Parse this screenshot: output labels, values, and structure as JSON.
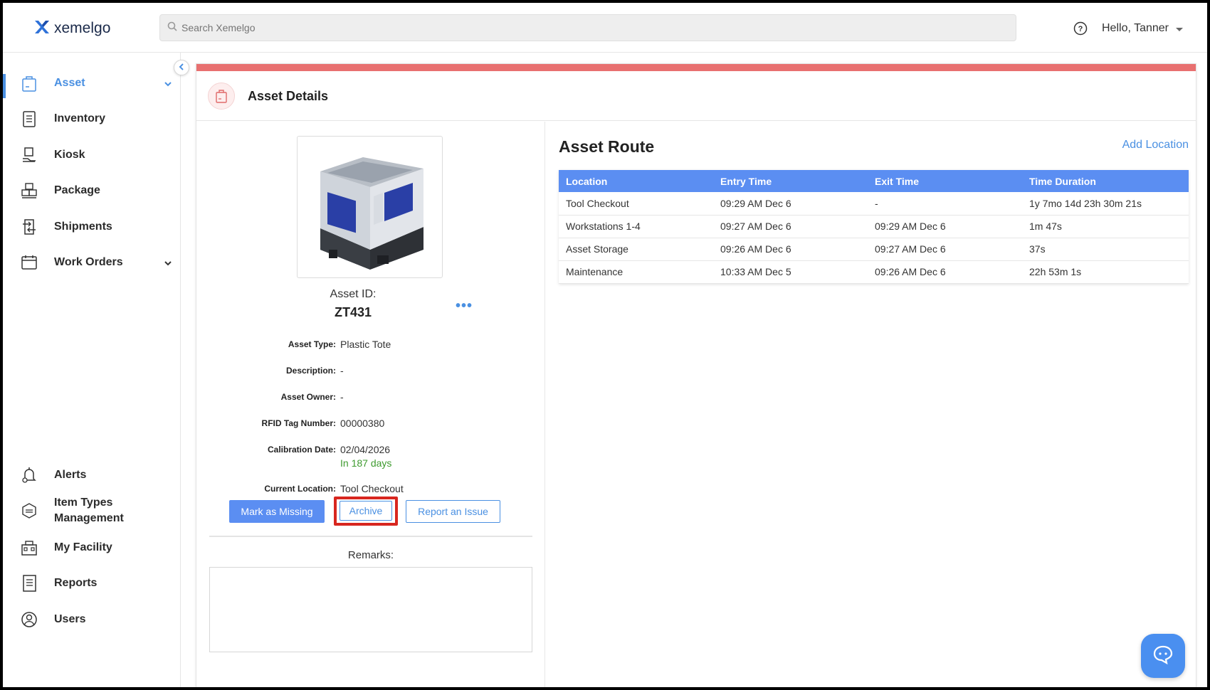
{
  "app": {
    "name": "xemelgo"
  },
  "header": {
    "search_placeholder": "Search Xemelgo",
    "user_greeting": "Hello, Tanner"
  },
  "sidebar": {
    "items": [
      {
        "label": "Asset",
        "icon": "asset-icon",
        "active": true,
        "expandable": true
      },
      {
        "label": "Inventory",
        "icon": "inventory-icon"
      },
      {
        "label": "Kiosk",
        "icon": "kiosk-icon"
      },
      {
        "label": "Package",
        "icon": "package-icon"
      },
      {
        "label": "Shipments",
        "icon": "shipments-icon"
      },
      {
        "label": "Work Orders",
        "icon": "work-orders-icon",
        "expandable": true
      },
      {
        "label": "Alerts",
        "icon": "alerts-icon"
      },
      {
        "label": "Item Types Management",
        "icon": "item-types-icon"
      },
      {
        "label": "My Facility",
        "icon": "facility-icon"
      },
      {
        "label": "Reports",
        "icon": "reports-icon"
      },
      {
        "label": "Users",
        "icon": "users-icon"
      }
    ],
    "accent_color": "#4a90e2"
  },
  "page": {
    "title": "Asset Details",
    "status_color": "#e87070"
  },
  "asset": {
    "id_label": "Asset ID:",
    "id": "ZT431",
    "fields": {
      "type_label": "Asset Type:",
      "type": "Plastic Tote",
      "description_label": "Description:",
      "description": "-",
      "owner_label": "Asset Owner:",
      "owner": "-",
      "rfid_label": "RFID Tag Number:",
      "rfid": "00000380",
      "calibration_label": "Calibration Date:",
      "calibration": "02/04/2026",
      "calibration_note": "In 187 days",
      "location_label": "Current Location:",
      "location": "Tool Checkout"
    },
    "actions": {
      "mark_missing": "Mark as Missing",
      "archive": "Archive",
      "report_issue": "Report an Issue"
    },
    "remarks_label": "Remarks:"
  },
  "route": {
    "title": "Asset Route",
    "add_location": "Add Location",
    "columns": [
      "Location",
      "Entry Time",
      "Exit Time",
      "Time Duration"
    ],
    "rows": [
      [
        "Tool Checkout",
        "09:29 AM Dec 6",
        "-",
        "1y 7mo 14d 23h 30m 21s"
      ],
      [
        "Workstations 1-4",
        "09:27 AM Dec 6",
        "09:29 AM Dec 6",
        "1m 47s"
      ],
      [
        "Asset Storage",
        "09:26 AM Dec 6",
        "09:27 AM Dec 6",
        "37s"
      ],
      [
        "Maintenance",
        "10:33 AM Dec 5",
        "09:26 AM Dec 6",
        "22h 53m 1s"
      ]
    ]
  }
}
